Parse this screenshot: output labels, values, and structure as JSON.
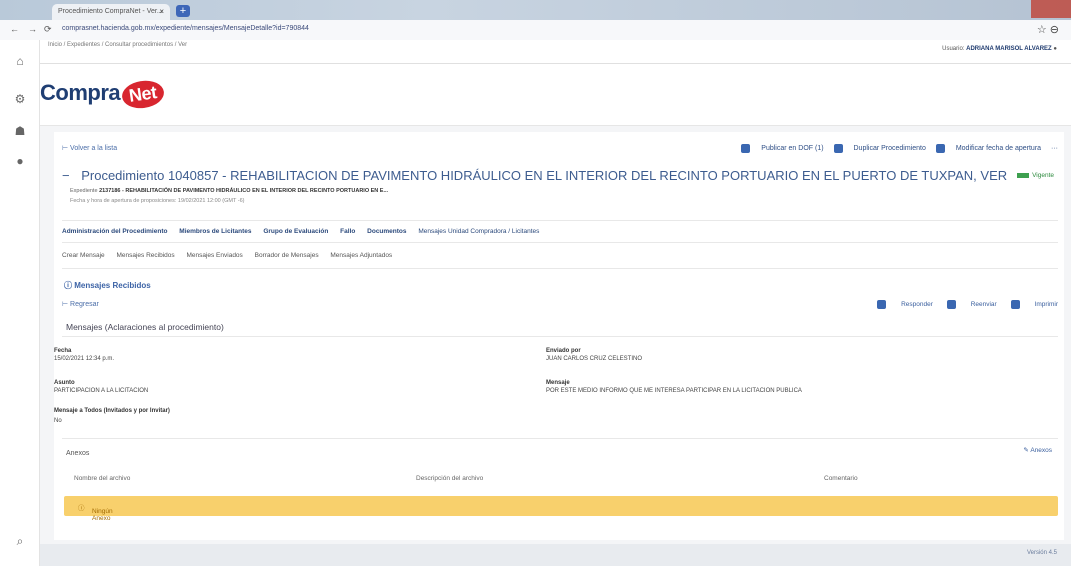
{
  "browser": {
    "tab_title": "Procedimiento CompraNet - Ver...",
    "url": "comprasnet.hacienda.gob.mx/expediente/mensajes/MensajeDetalle?id=790844",
    "breadcrumb_top": "Inicio / Expedientes / Consultar procedimientos / Ver",
    "user_label": "Usuario:",
    "user_name": "ADRIANA MARISOL ALVAREZ"
  },
  "app": {
    "logo_text": "Compra",
    "logo_badge": "Net"
  },
  "toolbar": {
    "back": "Volver a la lista",
    "publish_pdf": "Publicar en DOF (1)",
    "duplicate": "Duplicar Procedimiento",
    "modify_date": "Modificar fecha de apertura"
  },
  "procedure": {
    "label": "Procedimiento",
    "title": "1040857 - REHABILITACION DE PAVIMENTO HIDRÁULICO EN EL INTERIOR DEL RECINTO PORTUARIO EN EL PUERTO DE TUXPAN, VER",
    "status": "Vigente",
    "expediente_label": "Expediente",
    "expediente_value": "2137186 - REHABILITACIÓN DE PAVIMENTO HIDRÁULICO EN EL INTERIOR DEL RECINTO PORTUARIO EN E...",
    "fecha_apertura": "Fecha y hora de apertura de proposiciones: 19/02/2021 12:00 (GMT -6)"
  },
  "tabs_primary": [
    "Administración del Procedimiento",
    "Miembros de Licitantes",
    "Grupo de Evaluación",
    "Fallo",
    "Documentos",
    "Mensajes Unidad Compradora / Licitantes"
  ],
  "tabs_secondary": [
    "Crear Mensaje",
    "Mensajes Recibidos",
    "Mensajes Enviados",
    "Borrador de Mensajes",
    "Mensajes Adjuntados"
  ],
  "messages": {
    "section_title": "Mensajes Recibidos",
    "back": "Regresar",
    "reply": "Responder",
    "forward": "Reenviar",
    "print": "Imprimir",
    "header": "Mensajes (Aclaraciones al procedimiento)",
    "fecha_label": "Fecha",
    "fecha_value": "15/02/2021 12:34 p.m.",
    "enviado_label": "Enviado por",
    "enviado_value": "JUAN CARLOS CRUZ CELESTINO",
    "asunto_label": "Asunto",
    "asunto_value": "PARTICIPACION A LA LICITACION",
    "mensaje_label": "Mensaje",
    "mensaje_value": "POR ESTE MEDIO INFORMO QUE ME INTERESA PARTICIPAR EN LA LICITACION PUBLICA",
    "todos_label": "Mensaje a Todos (Invitados y por Invitar)",
    "todos_value": "No"
  },
  "anexos": {
    "title": "Anexos",
    "button": "Anexos",
    "columns": [
      "Nombre del archivo",
      "Descripción del archivo",
      "Comentario"
    ],
    "empty": "Ningún Anexo"
  },
  "footer": {
    "version": "Versión 4.5"
  }
}
